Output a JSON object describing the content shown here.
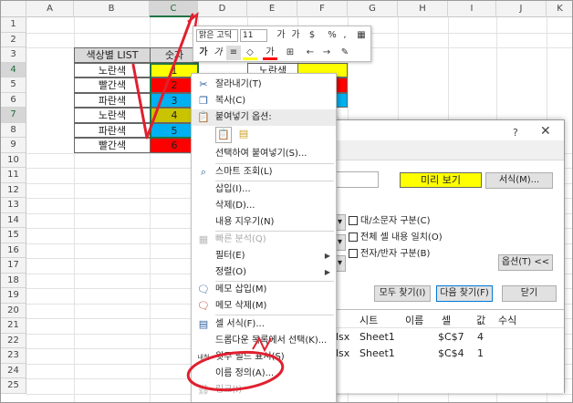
{
  "columns": [
    "",
    "A",
    "B",
    "C",
    "D",
    "E",
    "F",
    "G",
    "H",
    "I",
    "J",
    "K"
  ],
  "rows": [
    "1",
    "2",
    "3",
    "4",
    "5",
    "6",
    "7",
    "8",
    "9",
    "10",
    "11",
    "12",
    "13",
    "14",
    "15",
    "16",
    "17",
    "18",
    "19",
    "20",
    "21",
    "22",
    "23",
    "24",
    "25"
  ],
  "sheet": {
    "headers": {
      "list": "색상별 LIST",
      "number": "숫자"
    },
    "colors": [
      "노란색",
      "빨간색",
      "파란색",
      "노란색",
      "파란색",
      "빨간색"
    ],
    "numbers": [
      "1",
      "2",
      "3",
      "4",
      "5",
      "6"
    ],
    "partial_color": "노란색"
  },
  "minitoolbar": {
    "font": "맑은 고딕",
    "size": "11",
    "percent": "%",
    "comma": ","
  },
  "context_menu": {
    "cut": "잘라내기(T)",
    "copy": "복사(C)",
    "paste_options": "붙여넣기 옵션:",
    "paste_special": "선택하여 붙여넣기(S)...",
    "smart_lookup": "스마트 조회(L)",
    "insert": "삽입(I)...",
    "delete": "삭제(D)...",
    "clear": "내용 지우기(N)",
    "quick_analysis": "빠른 분석(Q)",
    "filter": "필터(E)",
    "sort": "정렬(O)",
    "insert_comment": "메모 삽입(M)",
    "delete_comment": "메모 삭제(M)",
    "format_cells": "셀 서식(F)...",
    "dropdown": "드롭다운 목록에서 선택(K)...",
    "phonetic": "윗주 필드 표시(S)",
    "define_name": "이름 정의(A)...",
    "hyperlink": "링크(I)"
  },
  "dialog": {
    "help": "?",
    "preview": "미리 보기",
    "format_btn": "서식(M)...",
    "match_case": "대/소문자 구분(C)",
    "entire_cell": "전체 셀 내용 일치(O)",
    "byte_match": "전자/반자 구분(B)",
    "options_btn": "옵션(T) <<",
    "find_all": "모두 찾기(I)",
    "find_next": "다음 찾기(F)",
    "close": "닫기",
    "result_headers": [
      "시트",
      "이름",
      "셀",
      "값",
      "수식"
    ],
    "results": [
      {
        "book": "lsx",
        "sheet": "Sheet1",
        "cell": "$C$7",
        "value": "4"
      },
      {
        "book": "lsx",
        "sheet": "Sheet1",
        "cell": "$C$4",
        "value": "1"
      }
    ]
  },
  "palette": {
    "yellow": "#ffff00",
    "red": "#ff0000",
    "blue": "#00b0f0",
    "olive": "#c9c300",
    "accent": "#217346",
    "circle": "#e0202f"
  }
}
